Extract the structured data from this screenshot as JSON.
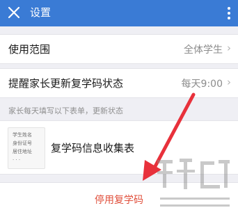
{
  "header": {
    "title": "设置"
  },
  "settings": {
    "scope": {
      "label": "使用范围",
      "value": "全体学生"
    },
    "reminder": {
      "label": "提醒家长更新复学码状态",
      "value": "每天9:00"
    },
    "hint": "家长每天填写以下表单，更新状态",
    "form": {
      "title": "复学码信息收集表",
      "thumb_lines": [
        "学生姓名",
        "身份证号",
        "居住地址",
        "· · ·"
      ]
    },
    "stop_label": "停用复学码"
  },
  "colors": {
    "header": "#3a7bd5",
    "danger": "#e04f3b",
    "arrow": "#e8313b"
  },
  "icons": [
    "close-icon",
    "more-icon",
    "chevron-right-icon"
  ]
}
